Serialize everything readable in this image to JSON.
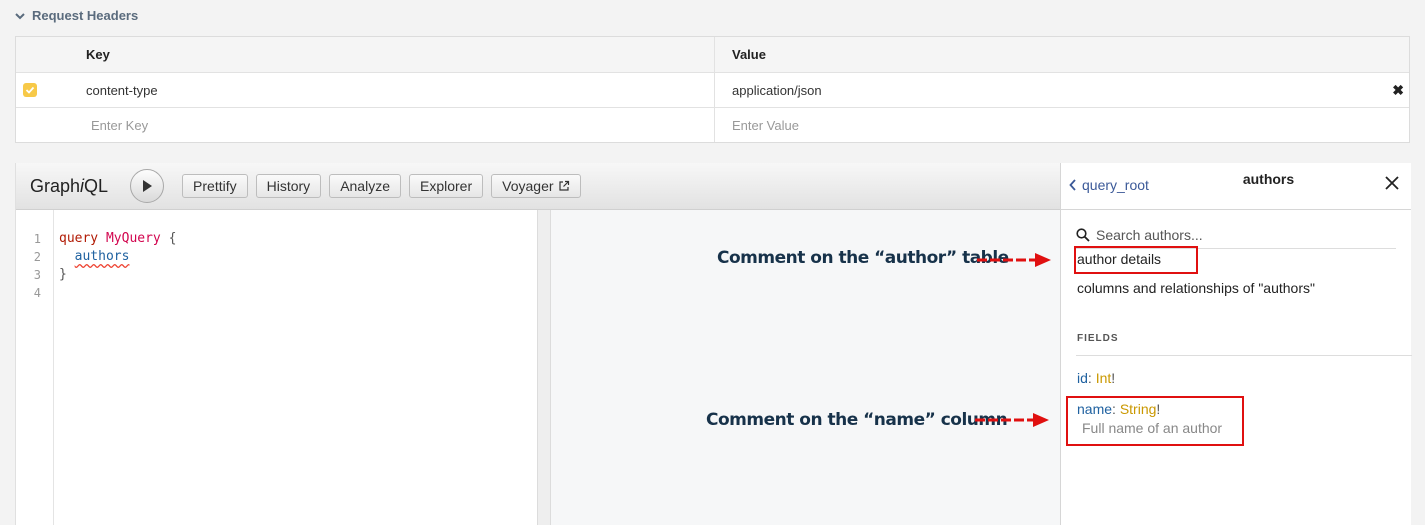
{
  "headers_section": {
    "title": "Request Headers",
    "columns": {
      "key": "Key",
      "value": "Value"
    },
    "rows": [
      {
        "key": "content-type",
        "value": "application/json",
        "checked": true
      }
    ],
    "new_row": {
      "key_placeholder": "Enter Key",
      "value_placeholder": "Enter Value"
    }
  },
  "graphiql": {
    "logo": {
      "pre": "Graph",
      "italic": "i",
      "post": "QL"
    },
    "toolbar": [
      {
        "label": "Prettify"
      },
      {
        "label": "History"
      },
      {
        "label": "Analyze"
      },
      {
        "label": "Explorer"
      },
      {
        "label": "Voyager"
      }
    ],
    "editor": {
      "line_numbers": [
        "1",
        "2",
        "3",
        "4"
      ],
      "line1": {
        "keyword": "query",
        "name": "MyQuery",
        "brace": "{"
      },
      "line2": {
        "field": "authors"
      },
      "line3": {
        "brace": "}"
      }
    }
  },
  "docs": {
    "back_label": "query_root",
    "title": "authors",
    "search_placeholder": "Search authors...",
    "description": "author details",
    "subdescription": "columns and relationships of \"authors\"",
    "fields_title": "FIELDS",
    "fields": [
      {
        "name": "id",
        "type": "Int",
        "bang": "!"
      },
      {
        "name": "name",
        "type": "String",
        "bang": "!",
        "description": "Full name of an author"
      }
    ]
  },
  "annotations": {
    "table_comment": "Comment on the “author” table",
    "column_comment": "Comment on the “name” column"
  },
  "colors": {
    "checkbox": "#f7c948",
    "annotation_red": "#e01010",
    "annotation_text": "#17324a",
    "type_color": "#ca9800",
    "field_color": "#1f61a0"
  }
}
